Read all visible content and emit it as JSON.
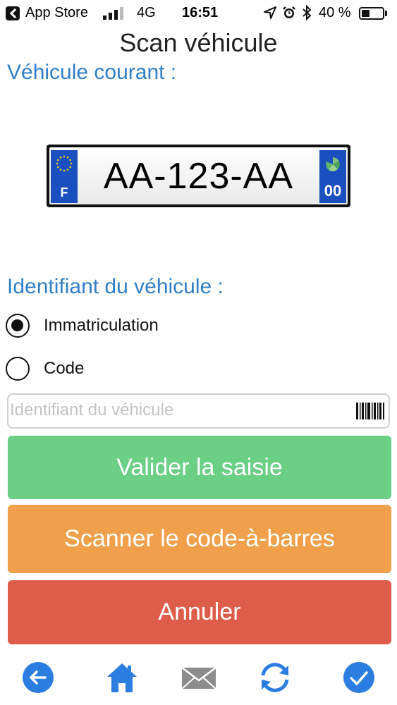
{
  "status_bar": {
    "back_app": "App Store",
    "network": "4G",
    "time": "16:51",
    "battery_percent": "40 %",
    "battery_level": 0.4
  },
  "nav": {
    "title": "Scan véhicule"
  },
  "current_vehicle": {
    "label": "Véhicule courant :",
    "plate": {
      "number": "AA-123-AA",
      "country_letter": "F",
      "department": "00"
    }
  },
  "identifier": {
    "label": "Identifiant du véhicule :",
    "options": [
      {
        "label": "Immatriculation",
        "selected": true
      },
      {
        "label": "Code",
        "selected": false
      }
    ],
    "input": {
      "value": "",
      "placeholder": "Identifiant du véhicule"
    }
  },
  "buttons": {
    "validate": "Valider la saisie",
    "scan": "Scanner le code-à-barres",
    "cancel": "Annuler"
  },
  "colors": {
    "accent": "#2f7fc8",
    "validate": "#6bcf86",
    "scan": "#f0a04b",
    "cancel": "#dd5c4a",
    "tab_icon": "#2b7de0"
  },
  "tabbar": {
    "icons": [
      "back-arrow-icon",
      "home-icon",
      "mail-icon",
      "sync-icon",
      "check-icon"
    ]
  }
}
